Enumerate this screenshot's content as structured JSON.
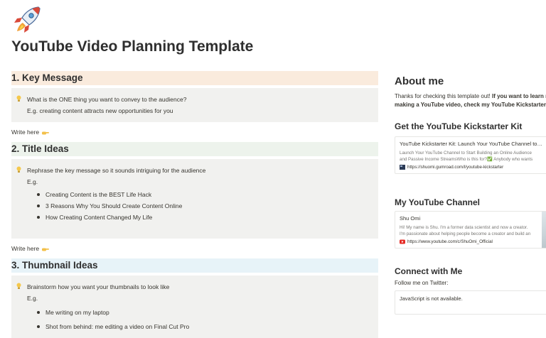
{
  "page": {
    "icon": "rocket-icon",
    "title": "YouTube Video Planning Template"
  },
  "sections": [
    {
      "heading": "1. Key Message",
      "color": "#faebdd",
      "callout": {
        "lines": [
          "What is the ONE thing you want to convey to the audience?",
          "E.g. creating content attracts new opportunities for you"
        ],
        "bullets": []
      },
      "write_here": "Write here"
    },
    {
      "heading": "2. Title Ideas",
      "color": "#edf3ec",
      "callout": {
        "lines": [
          "Rephrase the key message so it sounds intriguing for the audience",
          "E.g."
        ],
        "bullets": [
          "Creating Content is the BEST Life Hack",
          "3 Reasons Why You Should Create Content Online",
          "How Creating Content Changed My Life"
        ]
      },
      "write_here": "Write here"
    },
    {
      "heading": "3. Thumbnail Ideas",
      "color": "#e7f3f8",
      "callout": {
        "lines": [
          "Brainstorm how you want your thumbnails to look like",
          "E.g."
        ],
        "bullets": [
          "Me writing on my laptop",
          "Shot from behind: me editing a video on Final Cut Pro"
        ]
      }
    }
  ],
  "sidebar": {
    "about_heading": "About me",
    "about_line1_normal": "Thanks for checking this template out! ",
    "about_line1_bold": "If you want to learn m",
    "about_line2": "making a YouTube video, check my YouTube Kickstarter Kit",
    "kit_heading": "Get the YouTube Kickstarter Kit",
    "kit_bookmark": {
      "title": "YouTube Kickstarter Kit: Launch Your YouTube Channel to…",
      "desc1": "Launch Your YouTube Channel to Start Building an Online Audience",
      "desc2": "and Passive Income StreamsWho is this for?✅ Anybody who wants",
      "url": "https://shuomi.gumroad.com/l/youtube-kickstarter"
    },
    "channel_heading": "My YouTube Channel",
    "channel_bookmark": {
      "title": "Shu Omi",
      "desc1": "Hi! My name is Shu. I'm a former data scientist and now a creator.",
      "desc2": "I'm passionate about helping people become a creator and build an",
      "url": "https://www.youtube.com/c/ShuOmi_Official"
    },
    "connect_heading": "Connect with Me",
    "follow_text": "Follow me on Twitter:",
    "embed_text": "JavaScript is not available."
  },
  "colors": {
    "callout_bg": "#f1f1ef",
    "text": "#37352f"
  }
}
